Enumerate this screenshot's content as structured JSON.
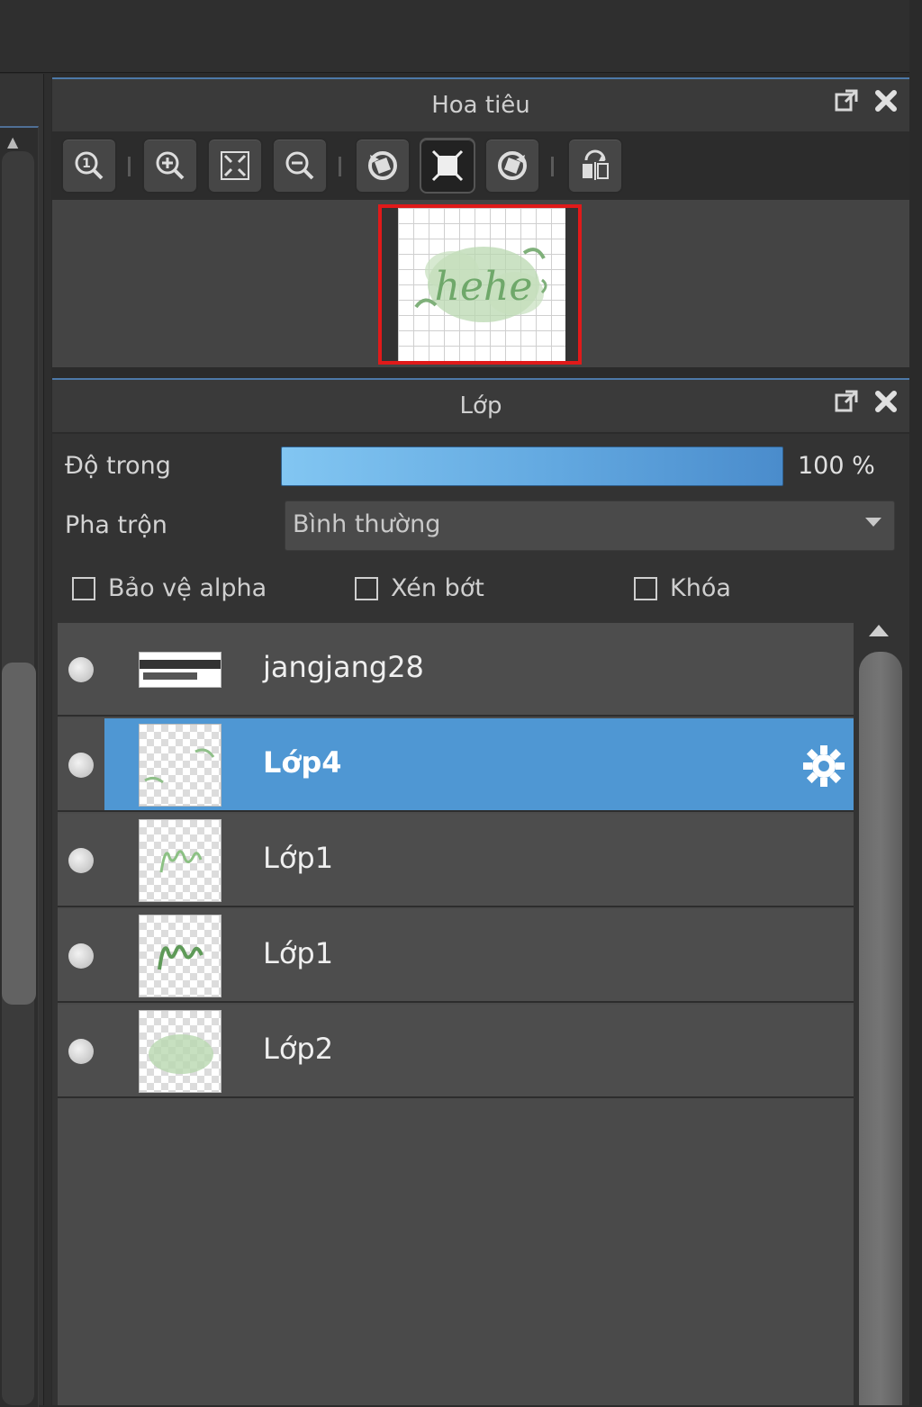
{
  "navigator": {
    "title": "Hoa tiêu",
    "toolbar": [
      "zoom-actual-icon",
      "zoom-in-icon",
      "fit-screen-icon",
      "zoom-out-icon",
      "rotate-left-icon",
      "fit-canvas-icon",
      "rotate-right-icon",
      "flip-horizontal-icon"
    ],
    "preview_text": "hehe"
  },
  "layers_panel": {
    "title": "Lớp",
    "opacity_label": "Độ trong",
    "opacity_value": "100 %",
    "opacity_fraction": 1.0,
    "blend_label": "Pha trộn",
    "blend_value": "Bình thường",
    "checkboxes": {
      "protect_alpha": "Bảo vệ alpha",
      "clipping": "Xén bớt",
      "lock": "Khóa"
    },
    "layers": [
      {
        "name": "jangjang28",
        "selected": false
      },
      {
        "name": "Lớp4",
        "selected": true
      },
      {
        "name": "Lớp1",
        "selected": false
      },
      {
        "name": "Lớp1",
        "selected": false
      },
      {
        "name": "Lớp2",
        "selected": false
      }
    ]
  },
  "colors": {
    "accent": "#4f97d3",
    "frame_red": "#e01a1a",
    "opacity_bar": "#62a8e0"
  }
}
